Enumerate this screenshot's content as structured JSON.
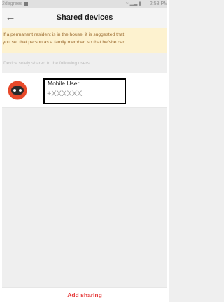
{
  "status_bar": {
    "carrier": "2degrees",
    "right": "     2:58 PM"
  },
  "header": {
    "back_icon": "←",
    "title": "Shared devices"
  },
  "notice": {
    "line1": "If a permanent resident is in the house, it is suggested that",
    "line2": "you set that person as a family member, so that he/she can"
  },
  "section": {
    "label": "Device solely shared to the following users"
  },
  "shared_users": [
    {
      "name": "Mobile User",
      "id": "+XXXXXX"
    }
  ],
  "footer": {
    "add_label": "Add sharing"
  },
  "colors": {
    "accent": "#e63d3d",
    "notice_bg": "#fdf2cf",
    "notice_text": "#9a6a2f",
    "avatar": "#e8492a"
  }
}
